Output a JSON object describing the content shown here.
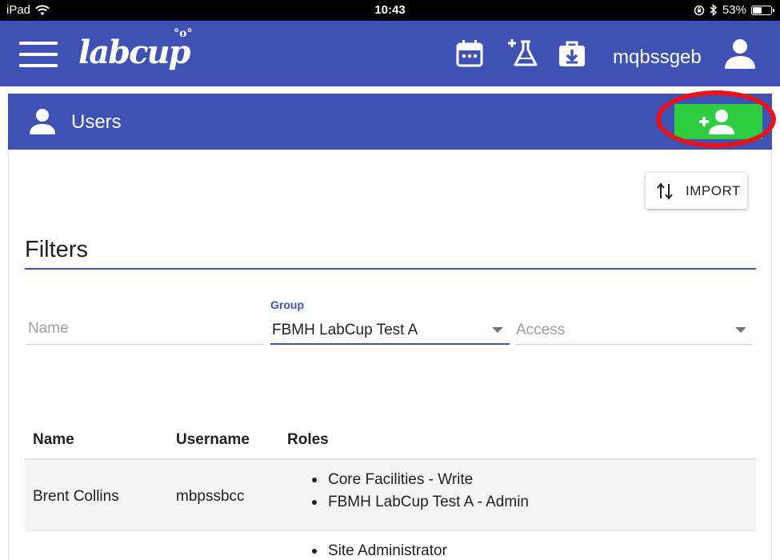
{
  "statusbar": {
    "device": "iPad",
    "time": "10:43",
    "battery": "53%"
  },
  "appbar": {
    "logo": "labcup",
    "username": "mqbssgeb"
  },
  "page": {
    "title": "Users"
  },
  "actions": {
    "import_label": "IMPORT"
  },
  "filters": {
    "title": "Filters",
    "name_placeholder": "Name",
    "group_label": "Group",
    "group_value": "FBMH LabCup Test A",
    "access_placeholder": "Access"
  },
  "table": {
    "headers": {
      "name": "Name",
      "username": "Username",
      "roles": "Roles"
    },
    "rows": [
      {
        "name": "Brent Collins",
        "username": "mbpssbcc",
        "roles": [
          "Core Facilities - Write",
          "FBMH LabCup Test A - Admin"
        ]
      },
      {
        "name": "",
        "username": "",
        "roles": [
          "Site Administrator"
        ]
      }
    ]
  },
  "colors": {
    "primary": "#3f51b5",
    "add_button": "#2ecc40",
    "highlight": "#e8141a"
  }
}
